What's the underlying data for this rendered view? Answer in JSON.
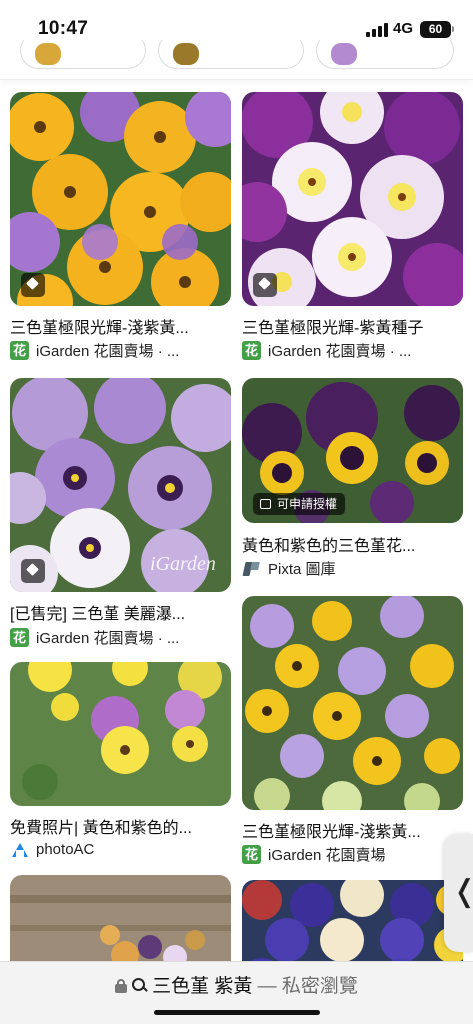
{
  "status_bar": {
    "time": "10:47",
    "network": "4G",
    "battery": "60"
  },
  "results": [
    {
      "title": "三色堇極限光輝-淺紫黃...",
      "source": "iGarden 花園賣場 · ...",
      "favicon": "igarden-icon",
      "badge": "tag-icon"
    },
    {
      "title": "三色堇極限光輝-紫黃種子",
      "source": "iGarden 花園賣場 · ...",
      "favicon": "igarden-icon",
      "badge": "tag-icon"
    },
    {
      "title": "[已售完] 三色堇 美麗瀑...",
      "source": "iGarden 花園賣場 · ...",
      "favicon": "igarden-icon",
      "badge": "tag-icon",
      "watermark": "iGarden"
    },
    {
      "title": "黃色和紫色的三色堇花...",
      "source": "Pixta 圖庫",
      "favicon": "pixta-icon",
      "badge_label": "可申請授權"
    },
    {
      "title": "免費照片| 黃色和紫色的...",
      "source": "photoAC",
      "favicon": "photoac-icon"
    },
    {
      "title": "三色堇極限光輝-淺紫黃...",
      "source": "iGarden 花園賣場",
      "favicon": "igarden-icon"
    }
  ],
  "favicon_letter": "花",
  "side_handle_glyph": "❬",
  "address_bar": {
    "query": "三色堇 紫黃",
    "suffix": "— 私密瀏覽"
  },
  "colors": {
    "accent_green": "#43a047",
    "pansy_purple": "#8e4fb5",
    "pansy_yellow": "#f6b51e"
  }
}
